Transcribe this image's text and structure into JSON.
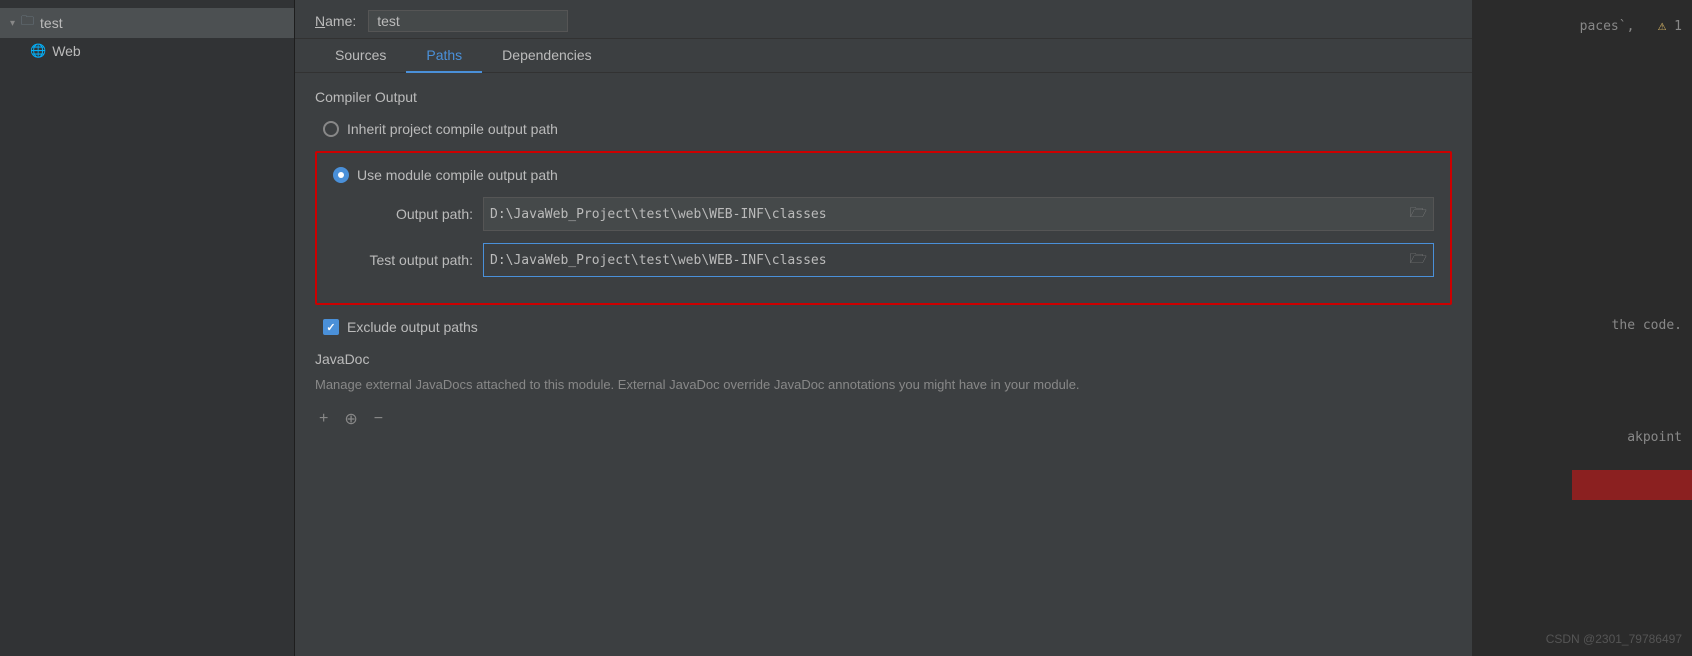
{
  "sidebar": {
    "root_item": {
      "label": "test",
      "chevron": "▾"
    },
    "child_item": {
      "label": "Web"
    }
  },
  "name_row": {
    "label": "Name:",
    "value": "test"
  },
  "tabs": [
    {
      "id": "sources",
      "label": "Sources",
      "active": false
    },
    {
      "id": "paths",
      "label": "Paths",
      "active": true
    },
    {
      "id": "dependencies",
      "label": "Dependencies",
      "active": false
    }
  ],
  "compiler_output": {
    "section_title": "Compiler Output",
    "radio_inherit": {
      "label": "Inherit project compile output path",
      "checked": false
    },
    "radio_module": {
      "label": "Use module compile output path",
      "checked": true
    },
    "output_path": {
      "label": "Output path:",
      "value": "D:\\JavaWeb_Project\\test\\web\\WEB-INF\\classes"
    },
    "test_output_path": {
      "label": "Test output path:",
      "value": "D:\\JavaWeb_Project\\test\\web\\WEB-INF\\classes"
    },
    "exclude_checkbox": {
      "label": "Exclude output paths",
      "checked": true
    }
  },
  "javadoc": {
    "title": "JavaDoc",
    "description": "Manage external JavaDocs attached to this module. External JavaDoc override JavaDoc annotations you might have in your module.",
    "buttons": {
      "add": "+",
      "add_from": "⊕",
      "remove": "−"
    }
  },
  "right_panel": {
    "text_top": "paces`,",
    "warning_count": "1",
    "text_mid": "the code.",
    "text_bot": "akpoint"
  }
}
